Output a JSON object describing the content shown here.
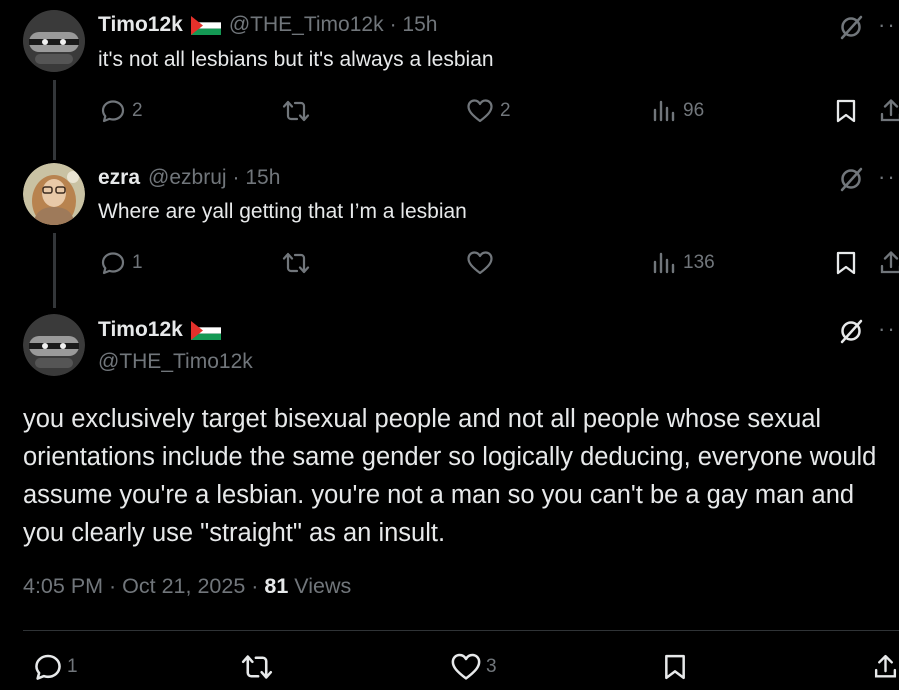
{
  "tweets": [
    {
      "name": "Timo12k",
      "handle": "@THE_Timo12k",
      "time": "· 15h",
      "text": "it's not all lesbians but it's always a lesbian",
      "replies": "2",
      "retweets": "",
      "likes": "2",
      "views": "96"
    },
    {
      "name": "ezra",
      "handle": "@ezbruj",
      "time": "· 15h",
      "text": "Where are yall getting that I’m a lesbian",
      "replies": "1",
      "retweets": "",
      "likes": "",
      "views": "136"
    }
  ],
  "main": {
    "name": "Timo12k",
    "handle": "@THE_Timo12k",
    "text": "you exclusively target bisexual people and not all people whose sexual orientations include the same gender so logically deducing, everyone would assume you're a lesbian. you're not a man so you can't be a gay man and you clearly use \"straight\" as an insult.",
    "time": "4:05 PM · Oct 21, 2025 · ",
    "views_count": "81",
    "views_label": " Views",
    "replies": "1",
    "likes": "3"
  },
  "icons": {
    "more": "more-icon",
    "grok": "grok-icon",
    "reply": "reply-icon",
    "retweet": "retweet-icon",
    "like": "like-icon",
    "views": "views-icon",
    "bookmark": "bookmark-icon",
    "share": "share-icon"
  },
  "colors": {
    "background": "#000000",
    "text": "#e7e9ea",
    "muted": "#71767b",
    "flag_black": "#000000",
    "flag_white": "#ffffff",
    "flag_green": "#149954",
    "flag_red": "#e4312b"
  }
}
